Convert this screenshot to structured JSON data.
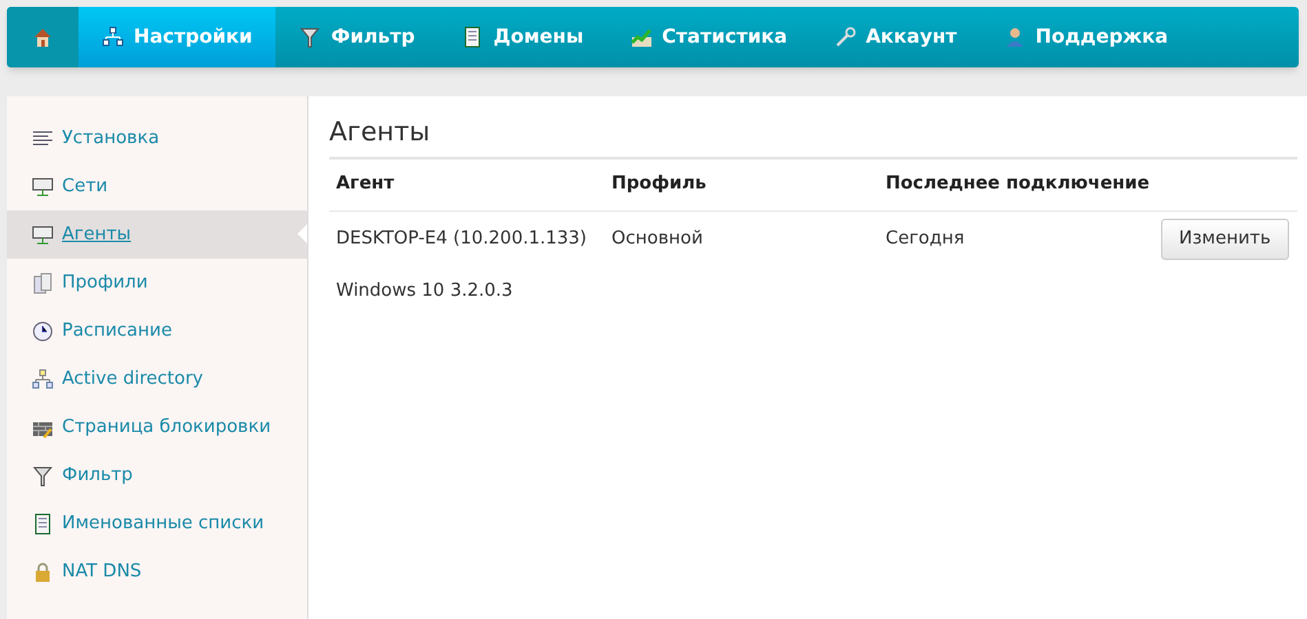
{
  "nav": [
    {
      "selected": false
    },
    {
      "label": "Настройки",
      "selected": true
    },
    {
      "label": "Фильтр",
      "selected": false
    },
    {
      "label": "Домены",
      "selected": false
    },
    {
      "label": "Статистика",
      "selected": false
    },
    {
      "label": "Аккаунт",
      "selected": false
    },
    {
      "label": "Поддержка",
      "selected": false
    }
  ],
  "sidebar": {
    "items": [
      {
        "label": "Установка",
        "selected": false
      },
      {
        "label": "Сети",
        "selected": false
      },
      {
        "label": "Агенты",
        "selected": true
      },
      {
        "label": "Профили",
        "selected": false
      },
      {
        "label": "Расписание",
        "selected": false
      },
      {
        "label": "Active directory",
        "selected": false
      },
      {
        "label": "Страница блокировки",
        "selected": false
      },
      {
        "label": "Фильтр",
        "selected": false
      },
      {
        "label": "Именованные списки",
        "selected": false
      },
      {
        "label": "NAT DNS",
        "selected": false
      }
    ]
  },
  "main": {
    "title": "Агенты",
    "table": {
      "columns": [
        "Агент",
        "Профиль",
        "Последнее подключение"
      ],
      "rows": [
        {
          "agent": "DESKTOP-E4 (10.200.1.133)",
          "profile": "Основной",
          "last": "Сегодня",
          "button": "Изменить",
          "detail": "Windows 10 3.2.0.3"
        }
      ]
    }
  }
}
